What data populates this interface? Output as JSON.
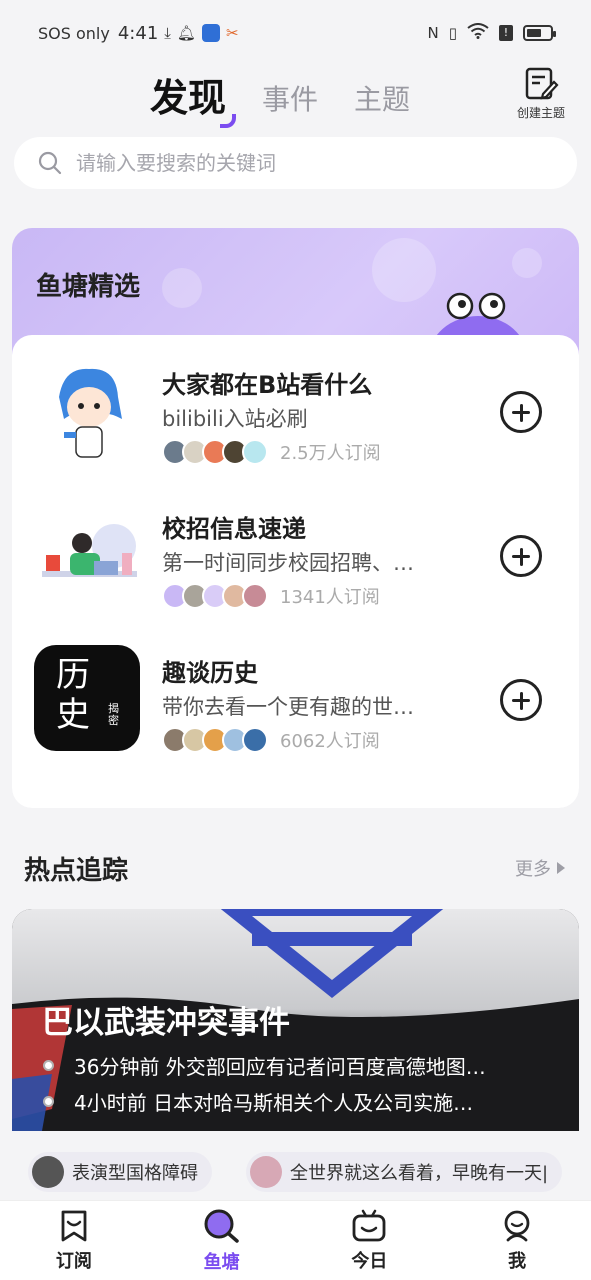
{
  "status_bar": {
    "carrier": "SOS only",
    "time": "4:41",
    "signal_label": "N"
  },
  "header": {
    "tabs": [
      {
        "label": "发现",
        "active": true
      },
      {
        "label": "事件",
        "active": false
      },
      {
        "label": "主题",
        "active": false
      }
    ],
    "create_topic_label": "创建主题"
  },
  "search": {
    "placeholder": "请输入要搜索的关键词"
  },
  "featured": {
    "title": "鱼塘精选",
    "items": [
      {
        "name": "大家都在B站看什么",
        "desc": "bilibili入站必刷",
        "subs": "2.5万人订阅"
      },
      {
        "name": "校招信息速递",
        "desc": "第一时间同步校园招聘、…",
        "subs": "1341人订阅"
      },
      {
        "name": "趣谈历史",
        "desc": "带你去看一个更有趣的世…",
        "subs": "6062人订阅",
        "thumb_text": "历史",
        "thumb_sub": "揭密"
      }
    ]
  },
  "hot": {
    "title": "热点追踪",
    "more_label": "更多",
    "event_title": "巴以武装冲突事件",
    "timeline": [
      "36分钟前 外交部回应有记者问百度高德地图…",
      "4小时前 日本对哈马斯相关个人及公司实施…"
    ],
    "chips": [
      "表演型国格障碍",
      "全世界就这么看着，早晚有一天|"
    ]
  },
  "bottom_nav": [
    {
      "label": "订阅",
      "icon": "bookmark-icon",
      "active": false
    },
    {
      "label": "鱼塘",
      "icon": "search-planet-icon",
      "active": true
    },
    {
      "label": "今日",
      "icon": "tv-icon",
      "active": false
    },
    {
      "label": "我",
      "icon": "profile-icon",
      "active": false
    }
  ],
  "colors": {
    "accent": "#7b4cf0",
    "featured_header": "#cdb9f7",
    "background": "#f4f4f6"
  }
}
